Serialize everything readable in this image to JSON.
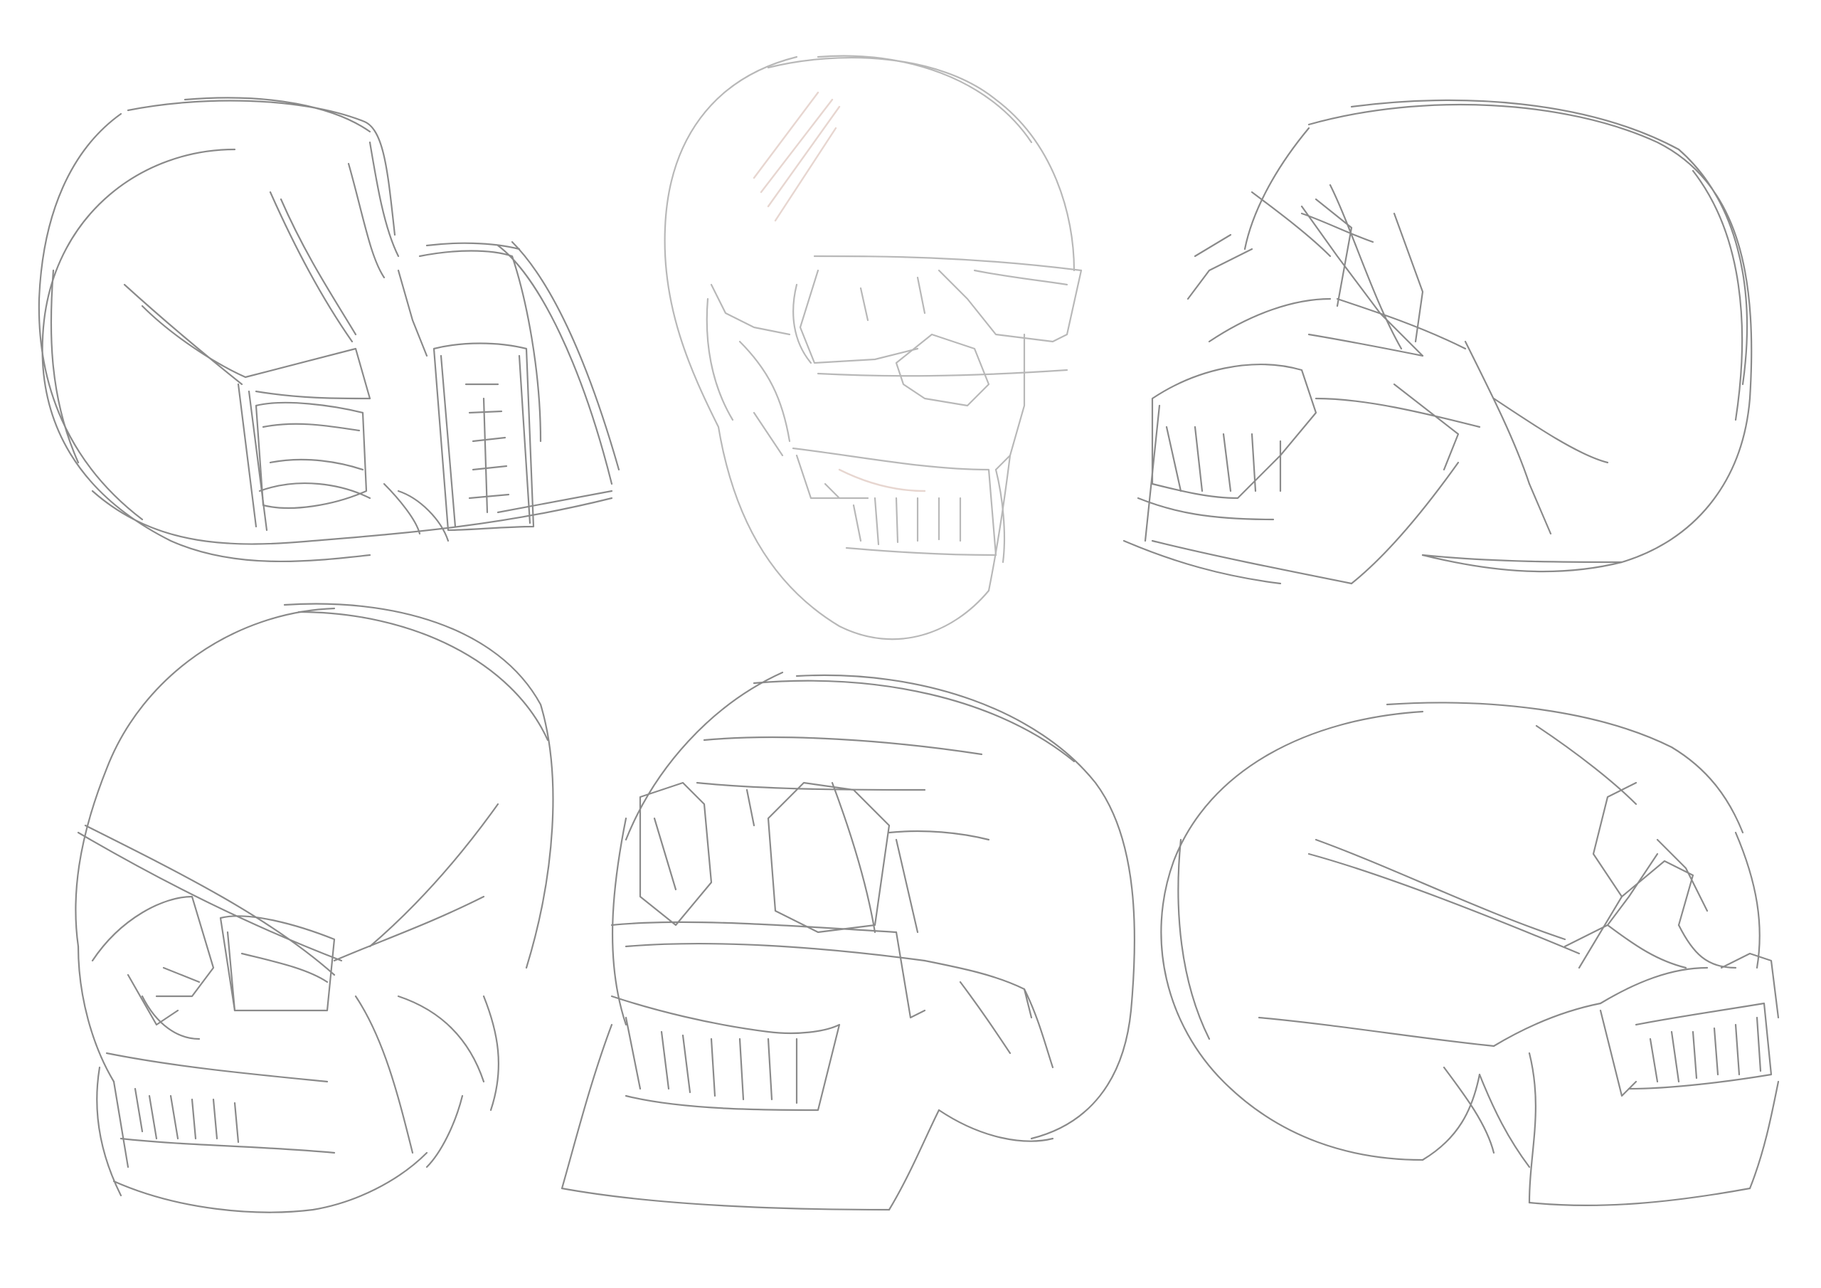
{
  "canvas": {
    "background": "#ffffff",
    "stroke_color": "#8a8a8a",
    "light_stroke_color": "#b8b8b8",
    "accent_stroke_color": "#e7d6d0"
  },
  "sketches": [
    {
      "view": "side-right-facing-down"
    },
    {
      "view": "front-three-quarter-light"
    },
    {
      "view": "side-left-facing"
    },
    {
      "view": "front-three-quarter-left"
    },
    {
      "view": "three-quarter-left-large"
    },
    {
      "view": "back-three-quarter-right"
    }
  ]
}
